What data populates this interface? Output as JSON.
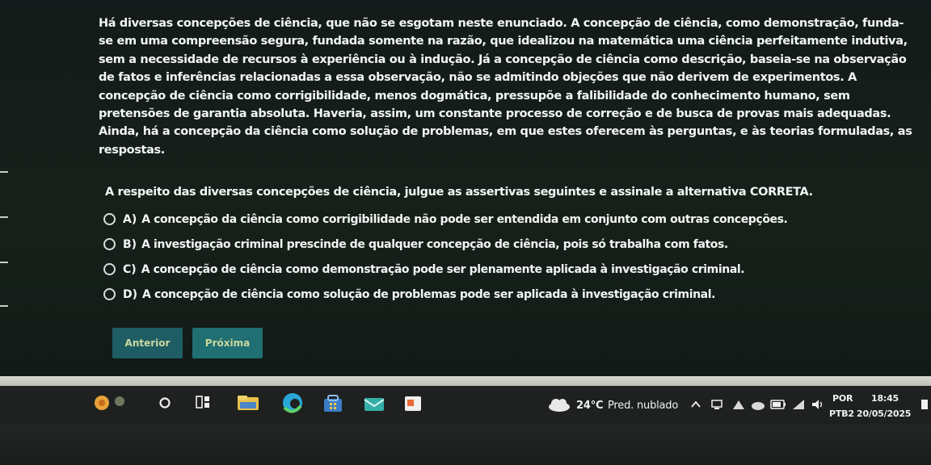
{
  "question": {
    "paragraph": "Há diversas concepções de ciência, que não se esgotam neste enunciado. A concepção de ciência, como demonstração, funda-se em uma compreensão segura, fundada somente na razão, que idealizou na matemática uma ciência perfeitamente indutiva, sem a necessidade de recursos à experiência ou à indução. Já a concepção de ciência como descrição, baseia-se na observação de fatos e inferências relacionadas a essa observação, não se admitindo objeções que não derivem de experimentos. A concepção de ciência como corrigibilidade, menos dogmática, pressupõe a falibilidade do conhecimento humano, sem pretensões de garantia absoluta. Haveria, assim, um constante processo de correção e de busca de provas mais adequadas. Ainda, há a concepção da ciência como solução de problemas, em que estes oferecem às perguntas, e às teorias formuladas, as respostas.",
    "prompt": "A respeito das diversas concepções de ciência, julgue as assertivas seguintes e assinale a alternativa CORRETA."
  },
  "options": [
    {
      "letter": "A)",
      "text": "A concepção da ciência como corrigibilidade não pode ser entendida em conjunto com outras concepções."
    },
    {
      "letter": "B)",
      "text": "A investigação criminal prescinde de qualquer concepção de ciência, pois só trabalha com fatos."
    },
    {
      "letter": "C)",
      "text": "A concepção de ciência como demonstração pode ser plenamente aplicada à investigação criminal."
    },
    {
      "letter": "D)",
      "text": "A concepção de ciência como solução de problemas pode ser aplicada à investigação criminal."
    }
  ],
  "nav": {
    "prev_label": "Anterior",
    "next_label": "Próxima"
  },
  "taskbar": {
    "weather_temp": "24°C",
    "weather_desc": "Pred. nublado",
    "lang_top": "POR",
    "lang_bottom": "PTB2",
    "time": "18:45",
    "date": "20/05/2025"
  },
  "colors": {
    "accent": "#1f6f73",
    "taskbar": "#1e2120"
  }
}
